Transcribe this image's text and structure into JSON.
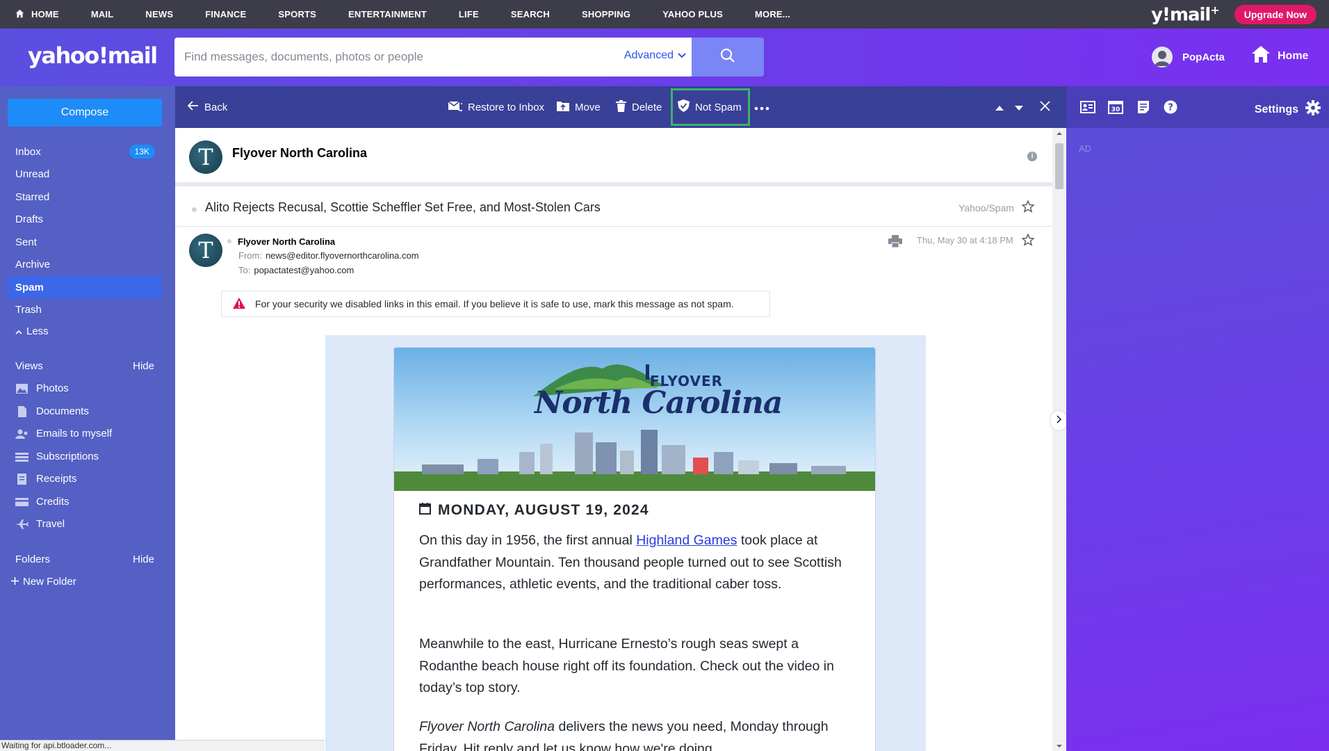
{
  "topnav": {
    "items": [
      "HOME",
      "MAIL",
      "NEWS",
      "FINANCE",
      "SPORTS",
      "ENTERTAINMENT",
      "LIFE",
      "SEARCH",
      "SHOPPING",
      "YAHOO PLUS",
      "MORE..."
    ],
    "brand": "y!mail",
    "brand_plus": "+",
    "upgrade": "Upgrade Now"
  },
  "header": {
    "logo": "yahoo!mail",
    "search_placeholder": "Find messages, documents, photos or people",
    "advanced": "Advanced",
    "user": "PopActa",
    "home": "Home"
  },
  "sidebar": {
    "compose": "Compose",
    "folders": [
      {
        "label": "Inbox",
        "badge": "13K"
      },
      {
        "label": "Unread"
      },
      {
        "label": "Starred"
      },
      {
        "label": "Drafts"
      },
      {
        "label": "Sent"
      },
      {
        "label": "Archive"
      },
      {
        "label": "Spam"
      },
      {
        "label": "Trash"
      }
    ],
    "less": "Less",
    "views_title": "Views",
    "views_hide": "Hide",
    "views": [
      "Photos",
      "Documents",
      "Emails to myself",
      "Subscriptions",
      "Receipts",
      "Credits",
      "Travel"
    ],
    "folders_title": "Folders",
    "folders_hide": "Hide",
    "new_folder": "New Folder"
  },
  "toolbar": {
    "back": "Back",
    "restore": "Restore to Inbox",
    "move": "Move",
    "delete": "Delete",
    "not_spam": "Not Spam"
  },
  "rightpanel": {
    "settings": "Settings",
    "ad": "AD"
  },
  "message": {
    "sender_header": "Flyover North Carolina",
    "avatar_letter": "T",
    "subject": "Alito Rejects Recusal, Scottie Scheffler Set Free, and Most-Stolen Cars",
    "folder_path": "Yahoo/Spam",
    "from_name": "Flyover North Carolina",
    "from_label": "From:",
    "from_email": "news@editor.flyovernorthcarolina.com",
    "to_label": "To:",
    "to_email": "popactatest@yahoo.com",
    "date": "Thu, May 30 at 4:18 PM",
    "security_notice": "For your security we disabled links in this email. If you believe it is safe to use, mark this message as not spam."
  },
  "newsletter": {
    "brand_top": "FLYOVER",
    "brand_main": "North Carolina",
    "date": "MONDAY, AUGUST 19, 2024",
    "p1_before": "On this day in 1956, the first annual ",
    "p1_link": "Highland Games",
    "p1_after": " took place at Grandfather Mountain. Ten thousand people turned out to see Scottish performances, athletic events, and the traditional caber toss.",
    "p2": "Meanwhile to the east, Hurricane Ernesto’s rough seas swept a Rodanthe beach house right off its foundation. Check out the video in today’s top story.",
    "p3_italic": "Flyover North Carolina",
    "p3_rest": " delivers the news you need, Monday through Friday. Hit reply and let us know how we're doing."
  },
  "statusbar": "Waiting for api.btloader.com...",
  "colors": {
    "topnav": "#3d3d4a",
    "header_start": "#5b4fe0",
    "header_end": "#7a2ff0",
    "sidebar": "#5460c4",
    "toolbar": "#394097",
    "compose": "#1d8cf8",
    "upgrade": "#e0186a",
    "not_spam_highlight": "#3db36b"
  }
}
